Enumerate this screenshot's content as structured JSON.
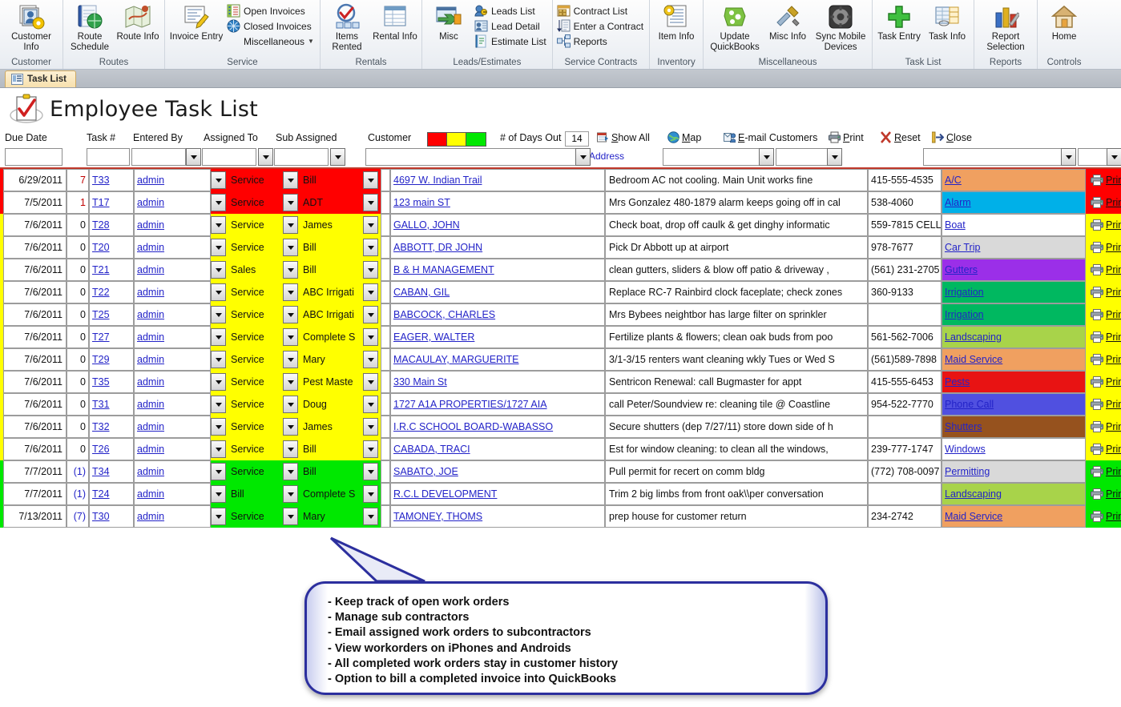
{
  "ribbon": {
    "groups": [
      {
        "name": "Customer",
        "label": "Customer",
        "big": [
          {
            "label": "Customer\nInfo",
            "icon": "customer-info-icon",
            "caret": true
          }
        ],
        "small": []
      },
      {
        "name": "Routes",
        "label": "Routes",
        "big": [
          {
            "label": "Route\nSchedule",
            "icon": "route-schedule-icon",
            "caret": false
          },
          {
            "label": "Route\nInfo",
            "icon": "route-info-icon",
            "caret": true
          }
        ],
        "small": []
      },
      {
        "name": "Service",
        "label": "Service",
        "big": [
          {
            "label": "Invoice\nEntry",
            "icon": "invoice-entry-icon",
            "caret": false
          }
        ],
        "small": [
          {
            "label": "Open Invoices",
            "icon": "open-invoices-icon",
            "caret": false
          },
          {
            "label": "Closed Invoices",
            "icon": "closed-invoices-icon",
            "caret": false
          },
          {
            "label": "Miscellaneous",
            "icon": "miscellaneous-icon",
            "caret": true
          }
        ]
      },
      {
        "name": "Rentals",
        "label": "Rentals",
        "big": [
          {
            "label": "Items\nRented",
            "icon": "items-rented-icon",
            "caret": false
          },
          {
            "label": "Rental\nInfo",
            "icon": "rental-info-icon",
            "caret": true
          }
        ],
        "small": []
      },
      {
        "name": "Leads/Estimates",
        "label": "Leads/Estimates",
        "big": [
          {
            "label": "Misc",
            "icon": "misc-leads-icon",
            "caret": true
          }
        ],
        "small": [
          {
            "label": "Leads List",
            "icon": "leads-list-icon",
            "caret": false
          },
          {
            "label": "Lead Detail",
            "icon": "lead-detail-icon",
            "caret": false
          },
          {
            "label": "Estimate List",
            "icon": "estimate-list-icon",
            "caret": false
          }
        ]
      },
      {
        "name": "Service Contracts",
        "label": "Service Contracts",
        "big": [],
        "small": [
          {
            "label": "Contract List",
            "icon": "contract-list-icon",
            "caret": false
          },
          {
            "label": "Enter a Contract",
            "icon": "enter-contract-icon",
            "caret": false
          },
          {
            "label": "Reports",
            "icon": "contract-reports-icon",
            "caret": false
          }
        ]
      },
      {
        "name": "Inventory",
        "label": "Inventory",
        "big": [
          {
            "label": "Item\nInfo",
            "icon": "item-info-icon",
            "caret": true
          }
        ],
        "small": []
      },
      {
        "name": "Miscellaneous",
        "label": "Miscellaneous",
        "big": [
          {
            "label": "Update\nQuickBooks",
            "icon": "update-quickbooks-icon",
            "caret": false
          },
          {
            "label": "Misc\nInfo",
            "icon": "misc-info-icon",
            "caret": true
          },
          {
            "label": "Sync Mobile\nDevices",
            "icon": "sync-mobile-devices-icon",
            "caret": false
          }
        ],
        "small": []
      },
      {
        "name": "Task List",
        "label": "Task List",
        "big": [
          {
            "label": "Task\nEntry",
            "icon": "task-entry-icon",
            "caret": false
          },
          {
            "label": "Task\nInfo",
            "icon": "task-info-icon",
            "caret": true
          }
        ],
        "small": []
      },
      {
        "name": "Reports",
        "label": "Reports",
        "big": [
          {
            "label": "Report\nSelection",
            "icon": "report-selection-icon",
            "caret": true
          }
        ],
        "small": []
      },
      {
        "name": "Controls",
        "label": "Controls",
        "big": [
          {
            "label": "Home",
            "icon": "home-icon",
            "caret": false
          }
        ],
        "small": []
      }
    ]
  },
  "doc_tab": {
    "label": "Task List",
    "icon": "task-list-tab-icon"
  },
  "page_title": "Employee Task List",
  "columns": {
    "due_date": "Due Date",
    "task_no": "Task #",
    "entered_by": "Entered By",
    "assigned_to": "Assigned To",
    "sub_assigned": "Sub Assigned",
    "customer": "Customer",
    "days_out_label": "# of Days Out",
    "days_out_value": "14",
    "address_link": "Address"
  },
  "legend_swatches": [
    {
      "name": "overdue",
      "color": "#FF0000"
    },
    {
      "name": "due-soon",
      "color": "#FFFF00"
    },
    {
      "name": "upcoming",
      "color": "#00E800"
    }
  ],
  "toolbar": [
    {
      "label": "Show All",
      "icon": "show-all-icon",
      "accel": "S"
    },
    {
      "label": "Map",
      "icon": "map-icon",
      "accel": "M"
    },
    {
      "label": "E-mail Customers",
      "icon": "email-customers-icon",
      "accel": "E"
    },
    {
      "label": "Print",
      "icon": "print-icon",
      "accel": "P"
    },
    {
      "label": "Reset",
      "icon": "reset-icon",
      "accel": "R"
    },
    {
      "label": "Close",
      "icon": "close-icon",
      "accel": "C"
    }
  ],
  "row_print_label": "Print",
  "rows": [
    {
      "due_date": "6/29/2011",
      "days": "7",
      "days_style": "red",
      "task": "T33",
      "entered_by": "admin",
      "assigned_to": "Service",
      "sub_assigned": "Bill",
      "customer": "4697 W. Indian Trail",
      "description": "Bedroom AC not cooling.  Main Unit works fine",
      "phone": "415-555-4535",
      "category": "A/C",
      "cat_color": "#F0A060",
      "row_color": "#FF0000"
    },
    {
      "due_date": "7/5/2011",
      "days": "1",
      "days_style": "red",
      "task": "T17",
      "entered_by": "admin",
      "assigned_to": "Service",
      "sub_assigned": "ADT",
      "customer": "123 main ST",
      "description": "Mrs Gonzalez 480-1879 alarm keeps going off in cal",
      "phone": "538-4060",
      "category": "Alarm",
      "cat_color": "#00B0E8",
      "row_color": "#FF0000"
    },
    {
      "due_date": "7/6/2011",
      "days": "0",
      "days_style": "black",
      "task": "T28",
      "entered_by": "admin",
      "assigned_to": "Service",
      "sub_assigned": "James",
      "customer": "GALLO, JOHN",
      "description": "Check boat, drop off caulk & get dinghy informatic",
      "phone": "559-7815 CELL",
      "category": "Boat",
      "cat_color": "#FFFFFF",
      "row_color": "#FFFF00"
    },
    {
      "due_date": "7/6/2011",
      "days": "0",
      "days_style": "black",
      "task": "T20",
      "entered_by": "admin",
      "assigned_to": "Service",
      "sub_assigned": "Bill",
      "customer": "ABBOTT, DR JOHN",
      "description": "Pick Dr Abbott up at airport",
      "phone": "978-7677",
      "category": "Car Trip",
      "cat_color": "#D9D9D9",
      "row_color": "#FFFF00"
    },
    {
      "due_date": "7/6/2011",
      "days": "0",
      "days_style": "black",
      "task": "T21",
      "entered_by": "admin",
      "assigned_to": "Sales",
      "sub_assigned": "Bill",
      "customer": "B & H MANAGEMENT",
      "description": "clean gutters, sliders & blow off patio & driveway ,",
      "phone": "(561) 231-2705",
      "category": "Gutters",
      "cat_color": "#9B2FE8",
      "row_color": "#FFFF00"
    },
    {
      "due_date": "7/6/2011",
      "days": "0",
      "days_style": "black",
      "task": "T22",
      "entered_by": "admin",
      "assigned_to": "Service",
      "sub_assigned": "ABC Irrigati",
      "customer": "CABAN, GIL",
      "description": "Replace RC-7 Rainbird clock faceplate; check zones",
      "phone": "360-9133",
      "category": "Irrigation",
      "cat_color": "#00B860",
      "row_color": "#FFFF00"
    },
    {
      "due_date": "7/6/2011",
      "days": "0",
      "days_style": "black",
      "task": "T25",
      "entered_by": "admin",
      "assigned_to": "Service",
      "sub_assigned": "ABC Irrigati",
      "customer": "BABCOCK, CHARLES",
      "description": "Mrs Bybees neightbor has large filter on sprinkler ",
      "phone": "",
      "category": "Irrigation",
      "cat_color": "#00B860",
      "row_color": "#FFFF00"
    },
    {
      "due_date": "7/6/2011",
      "days": "0",
      "days_style": "black",
      "task": "T27",
      "entered_by": "admin",
      "assigned_to": "Service",
      "sub_assigned": "Complete S",
      "customer": "EAGER, WALTER",
      "description": "Fertilize plants & flowers; clean oak buds from poo",
      "phone": "561-562-7006",
      "category": "Landscaping",
      "cat_color": "#A8D34A",
      "row_color": "#FFFF00"
    },
    {
      "due_date": "7/6/2011",
      "days": "0",
      "days_style": "black",
      "task": "T29",
      "entered_by": "admin",
      "assigned_to": "Service",
      "sub_assigned": "Mary",
      "customer": "MACAULAY, MARGUERITE",
      "description": "3/1-3/15 renters want cleaning wkly Tues or Wed S",
      "phone": "(561)589-7898",
      "category": "Maid Service",
      "cat_color": "#F0A060",
      "row_color": "#FFFF00"
    },
    {
      "due_date": "7/6/2011",
      "days": "0",
      "days_style": "black",
      "task": "T35",
      "entered_by": "admin",
      "assigned_to": "Service",
      "sub_assigned": "Pest Maste",
      "customer": "330 Main St",
      "description": "Sentricon Renewal: call Bugmaster for appt",
      "phone": "415-555-6453",
      "category": "Pests",
      "cat_color": "#E81313",
      "row_color": "#FFFF00"
    },
    {
      "due_date": "7/6/2011",
      "days": "0",
      "days_style": "black",
      "task": "T31",
      "entered_by": "admin",
      "assigned_to": "Service",
      "sub_assigned": "Doug",
      "customer": "1727 A1A PROPERTIES/1727 AIA",
      "description": "call Peter/Soundview re: cleaning tile @ Coastline",
      "phone": "954-522-7770",
      "category": "Phone Call",
      "cat_color": "#5050E0",
      "row_color": "#FFFF00"
    },
    {
      "due_date": "7/6/2011",
      "days": "0",
      "days_style": "black",
      "task": "T32",
      "entered_by": "admin",
      "assigned_to": "Service",
      "sub_assigned": "James",
      "customer": "I.R.C SCHOOL BOARD-WABASSO",
      "description": "Secure shutters (dep 7/27/11) store down side of h",
      "phone": "",
      "category": "Shutters",
      "cat_color": "#96521E",
      "row_color": "#FFFF00"
    },
    {
      "due_date": "7/6/2011",
      "days": "0",
      "days_style": "black",
      "task": "T26",
      "entered_by": "admin",
      "assigned_to": "Service",
      "sub_assigned": "Bill",
      "customer": "CABADA, TRACI",
      "description": "Est for window cleaning: to clean  all the windows,",
      "phone": "239-777-1747",
      "category": "Windows",
      "cat_color": "#FFFFFF",
      "row_color": "#FFFF00"
    },
    {
      "due_date": "7/7/2011",
      "days": "(1)",
      "days_style": "blue",
      "task": "T34",
      "entered_by": "admin",
      "assigned_to": "Service",
      "sub_assigned": "Bill",
      "customer": "SABATO, JOE",
      "description": "Pull permit for recert on comm bldg",
      "phone": "(772) 708-0097",
      "category": "Permitting",
      "cat_color": "#D9D9D9",
      "row_color": "#00E800"
    },
    {
      "due_date": "7/7/2011",
      "days": "(1)",
      "days_style": "blue",
      "task": "T24",
      "entered_by": "admin",
      "assigned_to": "Bill",
      "sub_assigned": "Complete S",
      "customer": "R.C.L DEVELOPMENT",
      "description": "Trim 2 big limbs from front oak\\\\per conversation",
      "phone": "",
      "category": "Landscaping",
      "cat_color": "#A8D34A",
      "row_color": "#00E800"
    },
    {
      "due_date": "7/13/2011",
      "days": "(7)",
      "days_style": "blue",
      "task": "T30",
      "entered_by": "admin",
      "assigned_to": "Service",
      "sub_assigned": "Mary",
      "customer": "TAMONEY, THOMS",
      "description": "prep house for customer return",
      "phone": "234-2742",
      "category": "Maid Service",
      "cat_color": "#F0A060",
      "row_color": "#00E800"
    }
  ],
  "callout": {
    "lines": [
      "- Keep track of open work orders",
      "- Manage sub contractors",
      "- Email assigned work orders to subcontractors",
      "- View workorders on iPhones and Androids",
      "- All completed work orders stay in customer history",
      "- Option to bill a completed invoice into QuickBooks"
    ]
  }
}
